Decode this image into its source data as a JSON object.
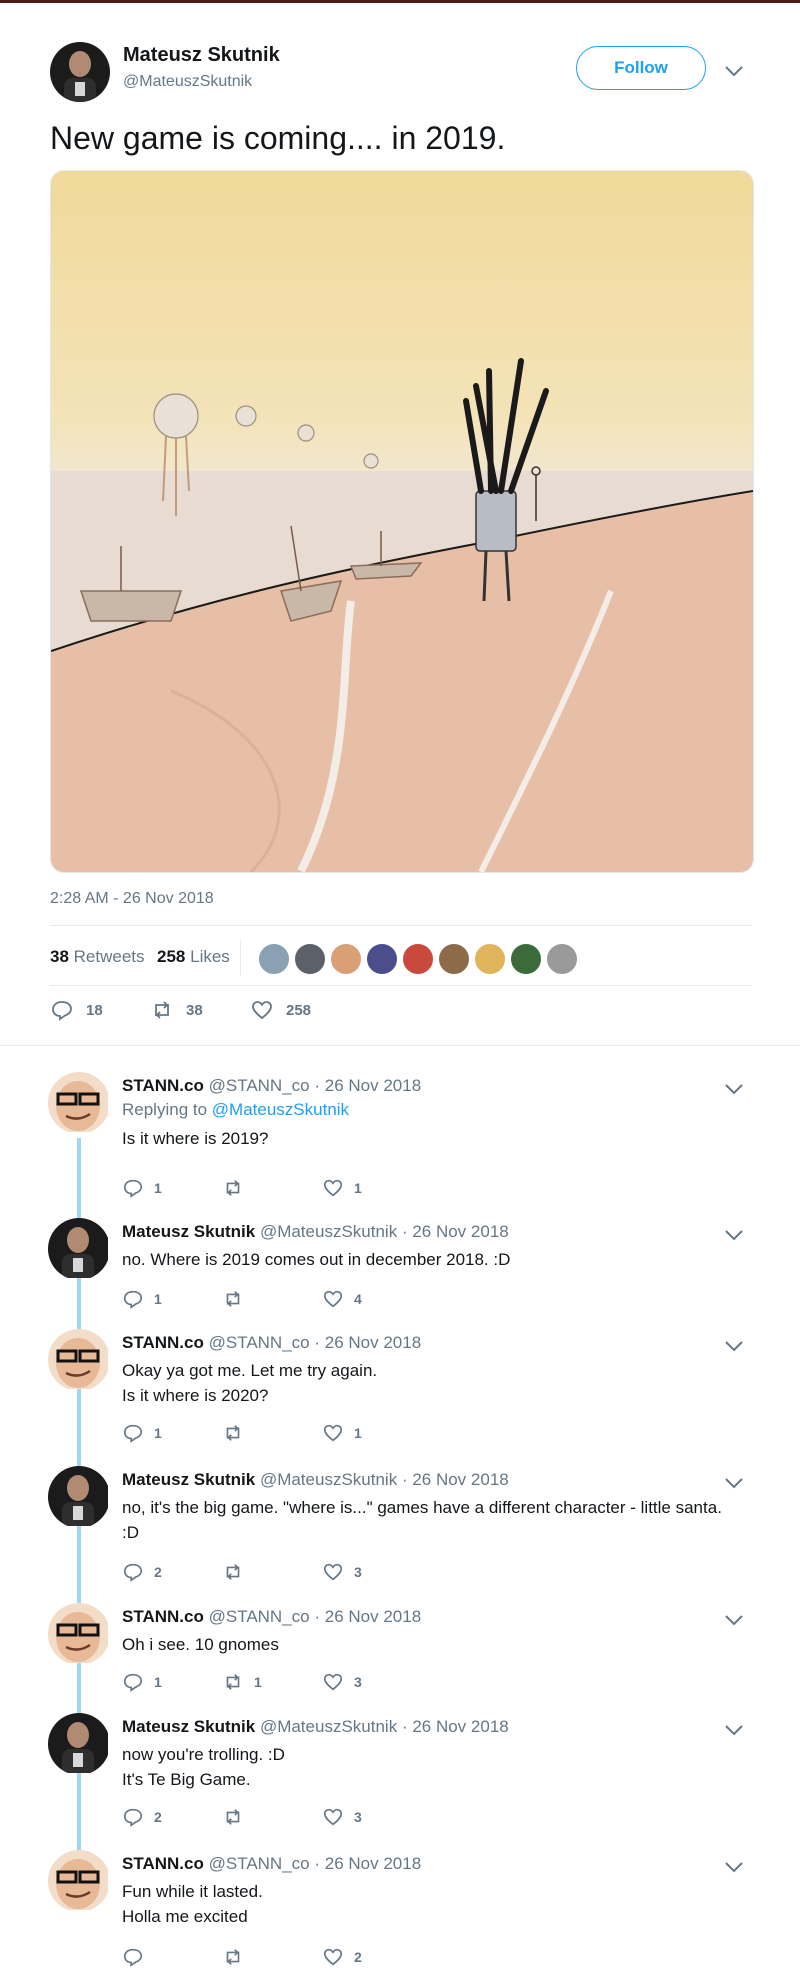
{
  "tweet": {
    "author_name": "Mateusz Skutnik",
    "author_handle": "@MateuszSkutnik",
    "follow_label": "Follow",
    "text": "New game is coming.... in 2019.",
    "timestamp": "2:28 AM - 26 Nov 2018",
    "retweets_count": "38",
    "retweets_label": "Retweets",
    "likes_count": "258",
    "likes_label": "Likes",
    "reply_count": "18",
    "retweet_count": "38",
    "like_count": "258"
  },
  "likers": [
    "#8aa0b3",
    "#5c6068",
    "#d9a076",
    "#4a4f8c",
    "#c94a3c",
    "#8b6b4a",
    "#e0b45a",
    "#3b6b3b",
    "#9a9a9a"
  ],
  "replies": [
    {
      "name": "STANN.co",
      "handle": "@STANN_co",
      "date": "· 26 Nov 2018",
      "replying_prefix": "Replying to",
      "replying_to": "@MateuszSkutnik",
      "text": "Is it where is 2019?",
      "reply_count": "1",
      "retweet_count": "",
      "like_count": "1"
    },
    {
      "name": "Mateusz Skutnik",
      "handle": "@MateuszSkutnik",
      "date": "· 26 Nov 2018",
      "text": "no. Where is 2019 comes out in december 2018. :D",
      "reply_count": "1",
      "retweet_count": "",
      "like_count": "4"
    },
    {
      "name": "STANN.co",
      "handle": "@STANN_co",
      "date": "· 26 Nov 2018",
      "text": "Okay ya got me. Let me try again.\nIs it where is 2020?",
      "reply_count": "1",
      "retweet_count": "",
      "like_count": "1"
    },
    {
      "name": "Mateusz Skutnik",
      "handle": "@MateuszSkutnik",
      "date": "· 26 Nov 2018",
      "text": "no, it's the big game. \"where is...\" games have a different character - little santa.\n:D",
      "reply_count": "2",
      "retweet_count": "",
      "like_count": "3"
    },
    {
      "name": "STANN.co",
      "handle": "@STANN_co",
      "date": "· 26 Nov 2018",
      "text": "Oh i see. 10 gnomes",
      "reply_count": "1",
      "retweet_count": "1",
      "like_count": "3"
    },
    {
      "name": "Mateusz Skutnik",
      "handle": "@MateuszSkutnik",
      "date": "· 26 Nov 2018",
      "text": "now you're trolling. :D\nIt's Te Big Game.",
      "reply_count": "2",
      "retweet_count": "",
      "like_count": "3"
    },
    {
      "name": "STANN.co",
      "handle": "@STANN_co",
      "date": "· 26 Nov 2018",
      "text": "Fun while it lasted.\nHolla me excited",
      "reply_count": "",
      "retweet_count": "",
      "like_count": "2"
    }
  ],
  "colors": {
    "accent": "#1da1f2",
    "muted": "#657786",
    "thread": "#9fd8f6"
  }
}
